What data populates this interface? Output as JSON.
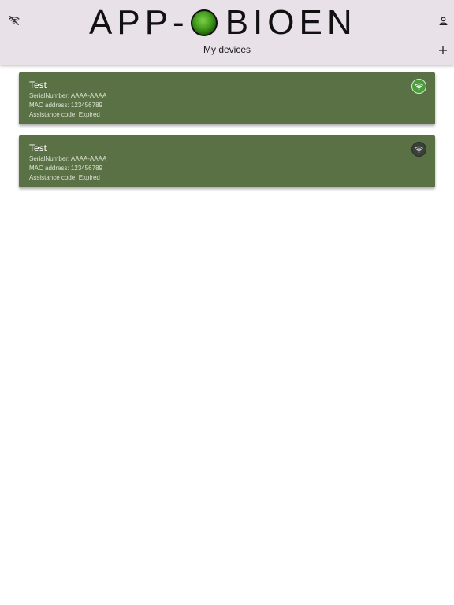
{
  "header": {
    "logo_left": "APP-",
    "logo_right": "BIOEN",
    "page_title": "My devices",
    "icons": {
      "connection": "wifi-off-icon",
      "account": "account-icon",
      "add": "add-icon"
    }
  },
  "devices": [
    {
      "name": "Test",
      "serial_label": "SerialNumber:",
      "serial": "AAAA-AAAA",
      "mac_label": "MAC address:",
      "mac": "123456789",
      "assistance_label": "Assistance code:",
      "assistance": "Expired",
      "status": "online",
      "status_color": "#4a9d3a"
    },
    {
      "name": "Test",
      "serial_label": "SerialNumber:",
      "serial": "AAAA-AAAA",
      "mac_label": "MAC address:",
      "mac": "123456789",
      "assistance_label": "Assistance code:",
      "assistance": "Expired",
      "status": "offline",
      "status_color": "#3b3f3a"
    }
  ],
  "colors": {
    "header_bg": "#e8e1e8",
    "card_bg": "#5a7045"
  }
}
